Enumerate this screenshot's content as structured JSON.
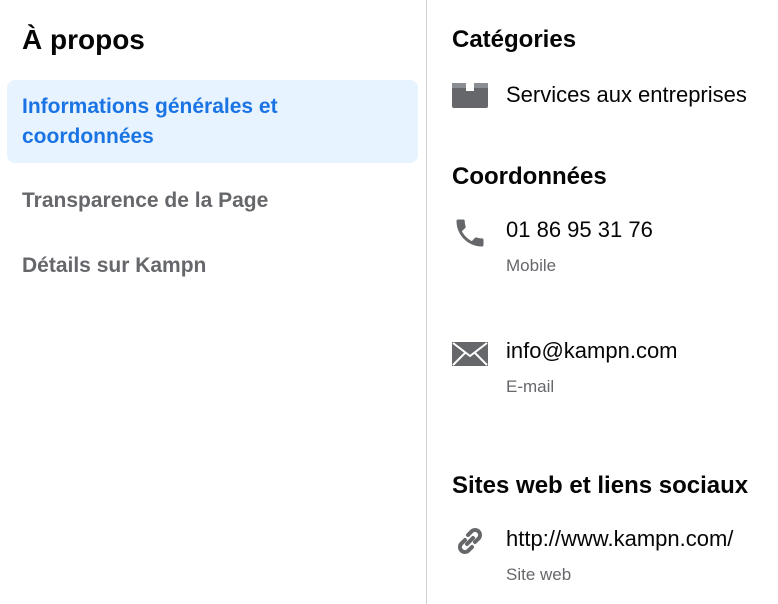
{
  "sidebar": {
    "title": "À propos",
    "items": [
      {
        "label": "Informations générales et coordonnées",
        "active": true
      },
      {
        "label": "Transparence de la Page",
        "active": false
      },
      {
        "label": "Détails sur Kampn",
        "active": false
      }
    ]
  },
  "categories": {
    "title": "Catégories",
    "icon": "briefcase-icon",
    "value": "Services aux entreprises"
  },
  "contact": {
    "title": "Coordonnées",
    "phone": {
      "icon": "phone-icon",
      "value": "01 86 95 31 76",
      "label": "Mobile"
    },
    "email": {
      "icon": "envelope-icon",
      "value": "info@kampn.com",
      "label": "E-mail"
    }
  },
  "websites": {
    "title": "Sites web et liens sociaux",
    "site": {
      "icon": "link-icon",
      "value": "http://www.kampn.com/",
      "label": "Site web"
    }
  },
  "colors": {
    "accent": "#1b74e4",
    "active_bg": "#e7f3ff",
    "muted_text": "#65676b",
    "icon": "#65676b",
    "divider": "#ced0d4"
  }
}
